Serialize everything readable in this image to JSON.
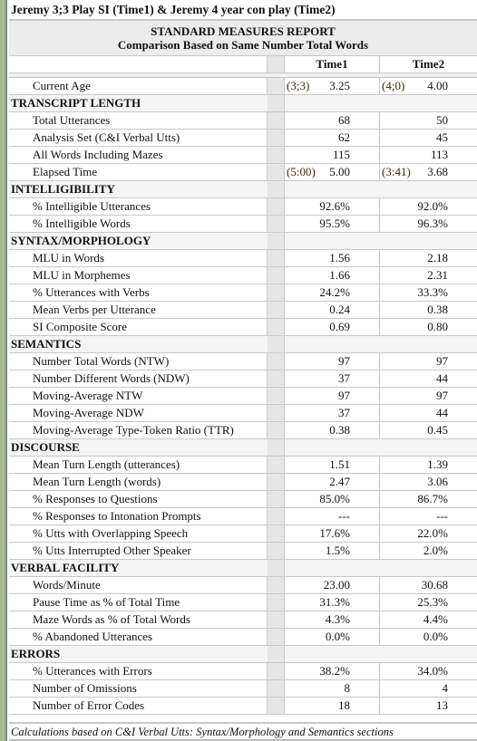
{
  "window_title": "Jeremy 3;3 Play SI (Time1) & Jeremy 4 year con play (Time2)",
  "report": {
    "title": "STANDARD MEASURES REPORT",
    "subtitle": "Comparison Based on Same Number Total Words",
    "col1": "Time1",
    "col2": "Time2"
  },
  "current_age": {
    "label": "Current Age",
    "t1_paren": "(3;3)",
    "t1": "3.25",
    "t2_paren": "(4;0)",
    "t2": "4.00"
  },
  "sections": [
    {
      "title": "TRANSCRIPT LENGTH",
      "rows": [
        {
          "label": "Total Utterances",
          "t1": "68",
          "t2": "50"
        },
        {
          "label": "Analysis Set (C&I Verbal Utts)",
          "t1": "62",
          "t2": "45"
        },
        {
          "label": "All Words Including Mazes",
          "t1": "115",
          "t2": "113"
        },
        {
          "label": "Elapsed Time",
          "t1_paren": "(5:00)",
          "t1": "5.00",
          "t2_paren": "(3:41)",
          "t2": "3.68"
        }
      ]
    },
    {
      "title": "INTELLIGIBILITY",
      "rows": [
        {
          "label": "% Intelligible Utterances",
          "t1": "92.6%",
          "t2": "92.0%"
        },
        {
          "label": "% Intelligible Words",
          "t1": "95.5%",
          "t2": "96.3%"
        }
      ]
    },
    {
      "title": "SYNTAX/MORPHOLOGY",
      "rows": [
        {
          "label": "MLU in Words",
          "t1": "1.56",
          "t2": "2.18"
        },
        {
          "label": "MLU in Morphemes",
          "t1": "1.66",
          "t2": "2.31"
        },
        {
          "label": "% Utterances with Verbs",
          "t1": "24.2%",
          "t2": "33.3%"
        },
        {
          "label": "Mean Verbs per Utterance",
          "t1": "0.24",
          "t2": "0.38"
        },
        {
          "label": "SI Composite Score",
          "t1": "0.69",
          "t2": "0.80"
        }
      ]
    },
    {
      "title": "SEMANTICS",
      "rows": [
        {
          "label": "Number Total Words (NTW)",
          "t1": "97",
          "t2": "97"
        },
        {
          "label": "Number Different Words (NDW)",
          "t1": "37",
          "t2": "44"
        },
        {
          "label": "Moving-Average NTW",
          "t1": "97",
          "t2": "97"
        },
        {
          "label": "Moving-Average NDW",
          "t1": "37",
          "t2": "44"
        },
        {
          "label": "Moving-Average Type-Token Ratio (TTR)",
          "t1": "0.38",
          "t2": "0.45"
        }
      ]
    },
    {
      "title": "DISCOURSE",
      "rows": [
        {
          "label": "Mean Turn Length (utterances)",
          "t1": "1.51",
          "t2": "1.39"
        },
        {
          "label": "Mean Turn Length (words)",
          "t1": "2.47",
          "t2": "3.06"
        },
        {
          "label": "% Responses to Questions",
          "t1": "85.0%",
          "t2": "86.7%"
        },
        {
          "label": "% Responses to Intonation Prompts",
          "t1": "---",
          "t2": "---"
        },
        {
          "label": "% Utts with Overlapping Speech",
          "t1": "17.6%",
          "t2": "22.0%"
        },
        {
          "label": "% Utts Interrupted Other Speaker",
          "t1": "1.5%",
          "t2": "2.0%"
        }
      ]
    },
    {
      "title": "VERBAL FACILITY",
      "rows": [
        {
          "label": "Words/Minute",
          "t1": "23.00",
          "t2": "30.68"
        },
        {
          "label": "Pause Time as % of Total Time",
          "t1": "31.3%",
          "t2": "25.3%"
        },
        {
          "label": "Maze Words as % of Total Words",
          "t1": "4.3%",
          "t2": "4.4%"
        },
        {
          "label": "% Abandoned Utterances",
          "t1": "0.0%",
          "t2": "0.0%"
        }
      ]
    },
    {
      "title": "ERRORS",
      "rows": [
        {
          "label": "% Utterances with Errors",
          "t1": "38.2%",
          "t2": "34.0%"
        },
        {
          "label": "Number of Omissions",
          "t1": "8",
          "t2": "4"
        },
        {
          "label": "Number of Error Codes",
          "t1": "18",
          "t2": "13"
        }
      ]
    }
  ],
  "footer": "Calculations based on C&I Verbal Utts: Syntax/Morphology and Semantics sections"
}
